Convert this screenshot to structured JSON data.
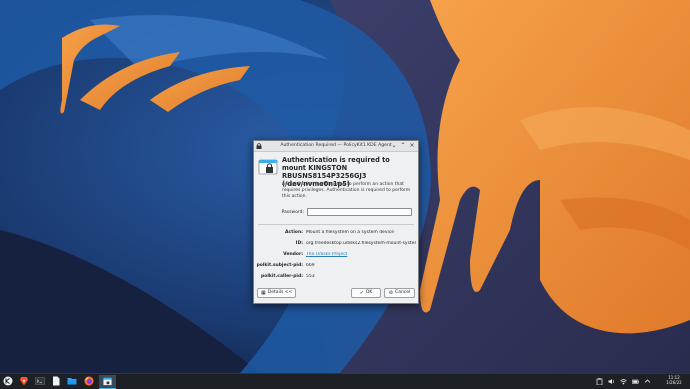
{
  "window": {
    "title": "Authentication Required — PolicyKit1 KDE Agent"
  },
  "dialog": {
    "heading": "Authentication is required to mount KINGSTON RBUSNS8154P3256GJ3 (/dev/nvme0n1p5)",
    "description": "An application is attempting to perform an action that requires privileges. Authentication is required to perform this action.",
    "password_label": "Password:",
    "password_value": "",
    "details": [
      {
        "label": "Action:",
        "value": "Mount a filesystem on a system device"
      },
      {
        "label": "ID:",
        "value": "org.freedesktop.udisks2.filesystem-mount-system"
      },
      {
        "label": "Vendor:",
        "value": "The Udisks Project"
      },
      {
        "label": "polkit.subject-pid:",
        "value": "669"
      },
      {
        "label": "polkit.caller-pid:",
        "value": "553"
      }
    ],
    "details_button": "Details <<",
    "ok_button": "OK",
    "cancel_button": "Cancel"
  },
  "taskbar": {
    "clock_time": "11:12",
    "clock_date": "1/26/22"
  },
  "colors": {
    "wallpaper_blue": "#1e4a8c",
    "wallpaper_orange": "#f0913a",
    "panel": "#1d2024",
    "link": "#2980b9"
  },
  "icons": [
    "application-menu-icon",
    "brave-browser-icon",
    "terminal-icon",
    "files-icon",
    "dolphin-icon",
    "firefox-icon",
    "lock-icon",
    "clipboard-icon",
    "volume-icon",
    "network-icon",
    "battery-icon",
    "chevron-up-icon"
  ]
}
